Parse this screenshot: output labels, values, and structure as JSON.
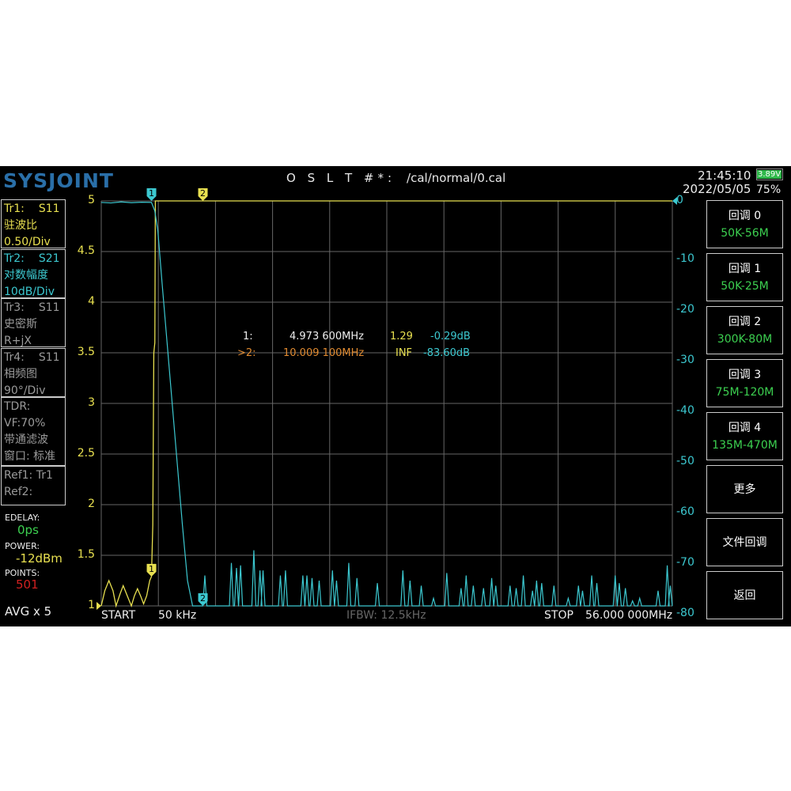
{
  "header": {
    "logo": "SYSJOINT",
    "cal_label": "O S L T #*:",
    "cal_file": "/cal/normal/0.cal",
    "time": "21:45:10",
    "date": "2022/05/05",
    "battery_voltage": "3.89V",
    "battery_percent": "75%"
  },
  "traces": [
    {
      "id": "Tr1:",
      "param": "S11",
      "format": "驻波比",
      "scale": "0.50/Div",
      "color": "#e8e050"
    },
    {
      "id": "Tr2:",
      "param": "S21",
      "format": "对数幅度",
      "scale": "10dB/Div",
      "color": "#3cc8d0"
    },
    {
      "id": "Tr3:",
      "param": "S11",
      "format": "史密斯",
      "scale": "R+jX",
      "color": "#9a9a9a"
    },
    {
      "id": "Tr4:",
      "param": "S11",
      "format": "相频图",
      "scale": "90°/Div",
      "color": "#9a9a9a"
    }
  ],
  "tdr": {
    "l1": "TDR:",
    "l2": "VF:70%",
    "l3": "带通滤波",
    "l4": "窗口: 标准"
  },
  "refs": {
    "ref1": "Ref1:  Tr1",
    "ref2": "Ref2:"
  },
  "settings": {
    "edelay_label": "EDELAY:",
    "edelay": "0ps",
    "power_label": "POWER:",
    "power": "-12dBm",
    "points_label": "POINTS:",
    "points": "501",
    "avg": "AVG x 5"
  },
  "markers": [
    {
      "label": "1:",
      "freq": "4.973 600MHz",
      "swr": "1.29",
      "db": "-0.29dB"
    },
    {
      "label": ">2:",
      "freq": "10.009 100MHz",
      "swr": "INF",
      "db": "-83.60dB"
    }
  ],
  "footer": {
    "start_label": "START",
    "start": "50 kHz",
    "ifbw": "IFBW: 12.5kHz",
    "stop_label": "STOP",
    "stop": "56.000 000MHz"
  },
  "softkeys": [
    {
      "label": "回调 0",
      "sub": "50K-56M"
    },
    {
      "label": "回调 1",
      "sub": "50K-25M"
    },
    {
      "label": "回调 2",
      "sub": "300K-80M"
    },
    {
      "label": "回调 3",
      "sub": "75M-120M"
    },
    {
      "label": "回调 4",
      "sub": "135M-470M"
    },
    {
      "label": "更多",
      "sub": ""
    },
    {
      "label": "文件回调",
      "sub": ""
    },
    {
      "label": "返回",
      "sub": ""
    }
  ],
  "chart_data": {
    "type": "line",
    "x_range_mhz": [
      0.05,
      56
    ],
    "left_axis": {
      "label": "SWR",
      "ticks": [
        "5",
        "4.5",
        "4",
        "3.5",
        "3",
        "2.5",
        "2",
        "1.5",
        "1"
      ],
      "range": [
        1,
        5
      ]
    },
    "right_axis": {
      "label": "dB",
      "ticks": [
        "0",
        "-10",
        "-20",
        "-30",
        "-40",
        "-50",
        "-60",
        "-70",
        "-80"
      ],
      "range": [
        -80,
        0
      ]
    },
    "series": [
      {
        "name": "Tr1 S11 SWR",
        "color": "#e8e050",
        "points": [
          [
            0.05,
            1.0
          ],
          [
            0.4,
            1.15
          ],
          [
            0.8,
            1.25
          ],
          [
            1.2,
            1.15
          ],
          [
            1.5,
            1.0
          ],
          [
            1.9,
            1.12
          ],
          [
            2.2,
            1.2
          ],
          [
            2.6,
            1.1
          ],
          [
            3.0,
            1.0
          ],
          [
            3.3,
            1.1
          ],
          [
            3.6,
            1.17
          ],
          [
            3.9,
            1.1
          ],
          [
            4.2,
            1.02
          ],
          [
            4.5,
            1.1
          ],
          [
            4.8,
            1.25
          ],
          [
            4.97,
            1.29
          ],
          [
            5.1,
            1.8
          ],
          [
            5.2,
            3.5
          ],
          [
            5.3,
            3.6
          ],
          [
            5.35,
            5
          ],
          [
            56,
            5
          ]
        ]
      },
      {
        "name": "Tr2 S21 LogMag",
        "color": "#3cc8d0",
        "points": [
          [
            0.05,
            -0.3
          ],
          [
            1,
            -0.4
          ],
          [
            2,
            -0.2
          ],
          [
            3,
            -0.35
          ],
          [
            4,
            -0.25
          ],
          [
            4.97,
            -0.29
          ],
          [
            5.3,
            -2
          ],
          [
            5.6,
            -6
          ],
          [
            6,
            -16
          ],
          [
            6.5,
            -28
          ],
          [
            7,
            -40
          ],
          [
            7.5,
            -52
          ],
          [
            8,
            -64
          ],
          [
            8.5,
            -75
          ],
          [
            9,
            -80
          ]
        ],
        "noise_floor": -80,
        "spikes": [
          [
            10.2,
            -74
          ],
          [
            12.8,
            -71.5
          ],
          [
            13.3,
            -72.5
          ],
          [
            13.7,
            -72
          ],
          [
            15.0,
            -69
          ],
          [
            15.6,
            -73
          ],
          [
            15.9,
            -73
          ],
          [
            17.6,
            -74
          ],
          [
            18.1,
            -73
          ],
          [
            19.8,
            -74
          ],
          [
            20.2,
            -74
          ],
          [
            20.7,
            -74.5
          ],
          [
            21.4,
            -75
          ],
          [
            22.7,
            -73
          ],
          [
            23.1,
            -75
          ],
          [
            24.3,
            -71.5
          ],
          [
            25.1,
            -74.5
          ],
          [
            27.1,
            -75.5
          ],
          [
            29.6,
            -73
          ],
          [
            30.3,
            -75
          ],
          [
            31.4,
            -76
          ],
          [
            32.6,
            -78.5
          ],
          [
            33.9,
            -73.5
          ],
          [
            35.3,
            -76.5
          ],
          [
            35.8,
            -74
          ],
          [
            36.5,
            -76
          ],
          [
            37.5,
            -76.5
          ],
          [
            38.3,
            -74.5
          ],
          [
            38.7,
            -76
          ],
          [
            40.1,
            -76
          ],
          [
            40.7,
            -76.5
          ],
          [
            41.4,
            -74
          ],
          [
            42.3,
            -77
          ],
          [
            42.7,
            -75
          ],
          [
            43.2,
            -75.5
          ],
          [
            44.4,
            -76
          ],
          [
            45.8,
            -78.5
          ],
          [
            46.8,
            -76
          ],
          [
            47.2,
            -77
          ],
          [
            48.1,
            -74
          ],
          [
            48.6,
            -75.5
          ],
          [
            50.4,
            -74
          ],
          [
            50.8,
            -75.5
          ],
          [
            51.4,
            -76.5
          ],
          [
            52.1,
            -79
          ],
          [
            52.8,
            -78.5
          ],
          [
            54.6,
            -77
          ],
          [
            55.5,
            -72
          ],
          [
            55.8,
            -76
          ]
        ]
      }
    ],
    "marker_positions_mhz": [
      4.9736,
      10.0091
    ]
  }
}
